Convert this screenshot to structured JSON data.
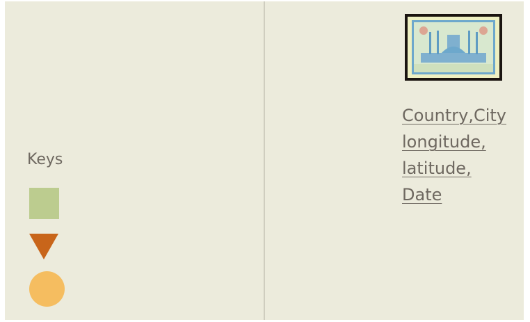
{
  "legend": {
    "title": "Keys",
    "items": [
      {
        "shape": "square",
        "color": "#bccc8f"
      },
      {
        "shape": "triangle-down",
        "color": "#c8651a"
      },
      {
        "shape": "circle",
        "color": "#f5bd60"
      }
    ]
  },
  "postcard": {
    "stamp": {
      "description": "postage stamp with mosque",
      "frame_color": "#6da8cc"
    },
    "address_lines": [
      "Country,City",
      "longitude,",
      "latitude,",
      "Date"
    ]
  }
}
